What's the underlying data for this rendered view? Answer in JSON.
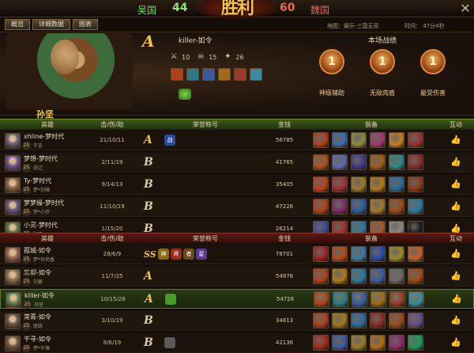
{
  "topbar": {
    "team_left": "吴国",
    "score_left": "44",
    "team_right": "魏国",
    "score_right": "60",
    "center_logo": "胜利"
  },
  "tabs": [
    "概览",
    "详细数据",
    "图表"
  ],
  "info": {
    "map": "地图：娱乐-三国无双",
    "time": "时间：   47分4秒"
  },
  "hero": {
    "rank": "A",
    "player": "killer-如令",
    "kda": {
      "kills": "10",
      "deaths": "15",
      "assists": "26"
    },
    "name": "孙坚"
  },
  "battle": {
    "title": "本场战绩",
    "badges": [
      {
        "label": "神级辅助",
        "num": "1"
      },
      {
        "label": "无敌肉盾",
        "num": "1"
      },
      {
        "label": "最受伤害",
        "num": "1"
      }
    ]
  },
  "table_headers": {
    "hero": "英雄",
    "kda": "击/伤/助",
    "honor": "荣誉称号",
    "money": "金钱",
    "equip": "装备",
    "interact": "互动"
  },
  "team1": [
    {
      "name": "xhline-梦时代",
      "level": "25",
      "nick": "于吉",
      "kda": "21/10/11",
      "rank": "A",
      "honors": [
        {
          "t": "战",
          "c": "#2a4a9a"
        }
      ],
      "money": "56785",
      "avatar": "#6a6a7a",
      "equip": [
        "#b0401a",
        "#3a6ab0",
        "#8a8a40",
        "#a03a6a",
        "#c08020",
        "#9a3030"
      ]
    },
    {
      "name": "梦想-梦时代",
      "level": "25",
      "nick": "张辽",
      "kda": "2/11/19",
      "rank": "B",
      "honors": [],
      "money": "41765",
      "avatar": "#7a5a9a",
      "equip": [
        "#b0501a",
        "#5a6ab0",
        "#3a3a8a",
        "#a05a1a",
        "#2a8a8a",
        "#8a2a2a"
      ]
    },
    {
      "name": "Ty-梦时代",
      "level": "25",
      "nick": "梦*刘禅",
      "kda": "9/14/13",
      "rank": "B",
      "honors": [],
      "money": "35405",
      "avatar": "#8a6a4a",
      "equip": [
        "#c0401a",
        "#a03030",
        "#9a7a2a",
        "#b07a1a",
        "#2a6a9a",
        "#8a3a1a"
      ]
    },
    {
      "name": "梦梦缘-梦时代",
      "level": "25",
      "nick": "梦*小乔",
      "kda": "11/10/19",
      "rank": "B",
      "honors": [],
      "money": "47226",
      "avatar": "#6a5a8a",
      "equip": [
        "#b0401a",
        "#7a2a6a",
        "#2a5aa0",
        "#a07a2a",
        "#9a4a1a",
        "#2a7aa0"
      ]
    },
    {
      "name": "小灵-梦时代",
      "level": "25",
      "nick": "顾雍",
      "kda": "1/15/20",
      "rank": "B",
      "honors": [],
      "money": "26214",
      "avatar": "#5a7a4a",
      "equip": [
        "#3a4aa0",
        "#a03030",
        "#2a7aa0",
        "#a05a2a",
        "#8a8a8a",
        "#1a1a1a"
      ]
    }
  ],
  "team2": [
    {
      "name": "孤城-如令",
      "level": "25",
      "nick": "梦*孙尚香",
      "kda": "28/6/9",
      "rank": "SS",
      "honors": [
        {
          "t": "神",
          "c": "#8a6a10"
        },
        {
          "t": "将",
          "c": "#9a2a1a"
        },
        {
          "t": "者",
          "c": "#6a4a1a"
        },
        {
          "t": "星",
          "c": "#5a3a8a"
        }
      ],
      "money": "78701",
      "avatar": "#9a6a5a",
      "equip": [
        "#a02020",
        "#b04a1a",
        "#3a7aa0",
        "#2a4aa0",
        "#9a8a2a",
        "#c0602a"
      ]
    },
    {
      "name": "忘却-如令",
      "level": "25",
      "nick": "刘备",
      "kda": "11/7/25",
      "rank": "A",
      "honors": [],
      "money": "54976",
      "avatar": "#8a7a5a",
      "equip": [
        "#b0401a",
        "#b07a1a",
        "#2a7aa0",
        "#3a5aa0",
        "#6a6a6a",
        "#a04a1a"
      ]
    },
    {
      "name": "killer-如令",
      "level": "25",
      "nick": "孙坚",
      "kda": "10/15/26",
      "rank": "A",
      "honors": [
        {
          "t": "",
          "c": "#4a9a2a"
        }
      ],
      "money": "54728",
      "avatar": "#6a8a5a",
      "equip": [
        "#b0401a",
        "#2a7a8a",
        "#3a5aa0",
        "#a06a1a",
        "#9a3a2a",
        "#3a8aa0"
      ]
    },
    {
      "name": "常青-如令",
      "level": "25",
      "nick": "庞统",
      "kda": "3/10/19",
      "rank": "B",
      "honors": [],
      "money": "34813",
      "avatar": "#6a5a4a",
      "equip": [
        "#b0401a",
        "#a07a1a",
        "#2a6aa0",
        "#8a2a2a",
        "#9a4a1a",
        "#6a4a8a"
      ]
    },
    {
      "name": "干寻-如令",
      "level": "25",
      "nick": "梦*许褚",
      "kda": "8/6/19",
      "rank": "B",
      "honors": [
        {
          "t": "",
          "c": "#5a5a5a"
        }
      ],
      "money": "42136",
      "avatar": "#7a5a4a",
      "equip": [
        "#a02a1a",
        "#3a5aa0",
        "#9a7a2a",
        "#b06a1a",
        "#8a2a6a",
        "#1a9a5a"
      ]
    }
  ]
}
